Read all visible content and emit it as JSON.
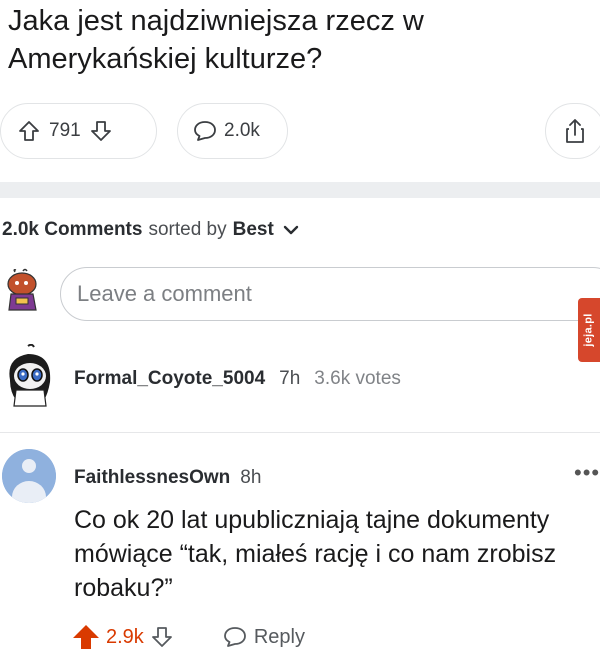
{
  "post": {
    "title": "Jaka jest najdziwniejsza rzecz w Amerykańskiej kulturze?",
    "votes": "791",
    "comments_count": "2.0k"
  },
  "sort": {
    "count": "2.0k",
    "comments_label": "Comments",
    "sorted_by": "sorted by",
    "value": "Best"
  },
  "composer": {
    "placeholder": "Leave a comment"
  },
  "watermark": {
    "text": "jeja.pl"
  },
  "comments": [
    {
      "username": "Formal_Coyote_5004",
      "time": "7h",
      "votes": "3.6k votes"
    },
    {
      "username": "FaithlessnesOwn",
      "time": "8h",
      "body": "Co ok 20 lat upubliczniają tajne dokumenty mówiące “tak, miałeś rację i co nam zrobisz robaku?”",
      "score": "2.9k",
      "reply_label": "Reply"
    }
  ],
  "colors": {
    "upvoted": "#d93a00",
    "divider": "#eceef0",
    "watermark": "#d6472c"
  }
}
